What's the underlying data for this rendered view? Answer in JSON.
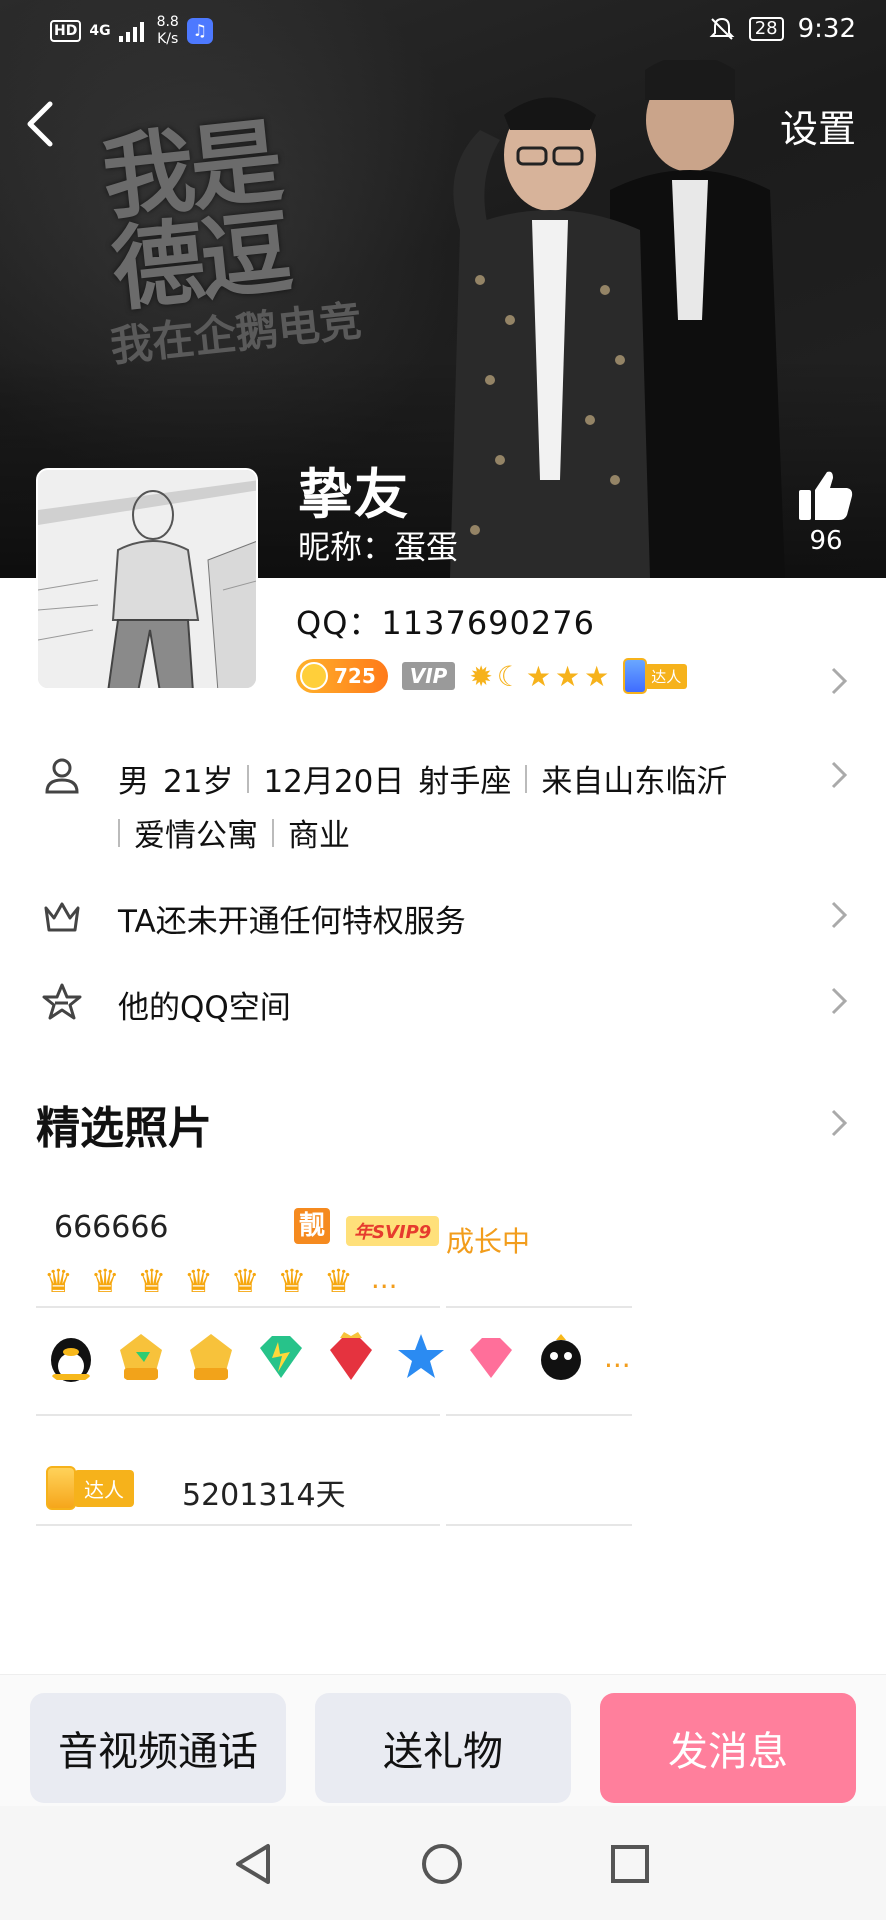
{
  "status_bar": {
    "hd": "HD",
    "signal": "4G",
    "speed_value": "8.8",
    "speed_unit": "K/s",
    "battery": "28",
    "time": "9:32"
  },
  "header": {
    "settings_label": "设置",
    "banner_line1": "我是",
    "banner_line2": "德逗",
    "banner_line3": "我在企鹅电竞",
    "title": "挚友",
    "nickname": "昵称：蛋蛋",
    "likes": "96"
  },
  "profile": {
    "qq": "QQ：1137690276",
    "coin_value": "725",
    "vip": "VIP",
    "daren": "达人"
  },
  "details": {
    "gender": "男",
    "age": "21岁",
    "birthday": "12月20日",
    "sign": "射手座",
    "location": "来自山东临沂",
    "tag1": "爱情公寓",
    "tag2": "商业",
    "privilege": "TA还未开通任何特权服务",
    "qzone": "他的QQ空间"
  },
  "section": {
    "title": "精选照片"
  },
  "cells": {
    "c1_text": "666666",
    "pretty": "靓",
    "svip": "年SVIP9",
    "growing": "成长中",
    "ellipsis": "...",
    "c3_daren": "达人",
    "c3_text": "5201314天"
  },
  "actions": {
    "call": "音视频通话",
    "gift": "送礼物",
    "message": "发消息"
  }
}
